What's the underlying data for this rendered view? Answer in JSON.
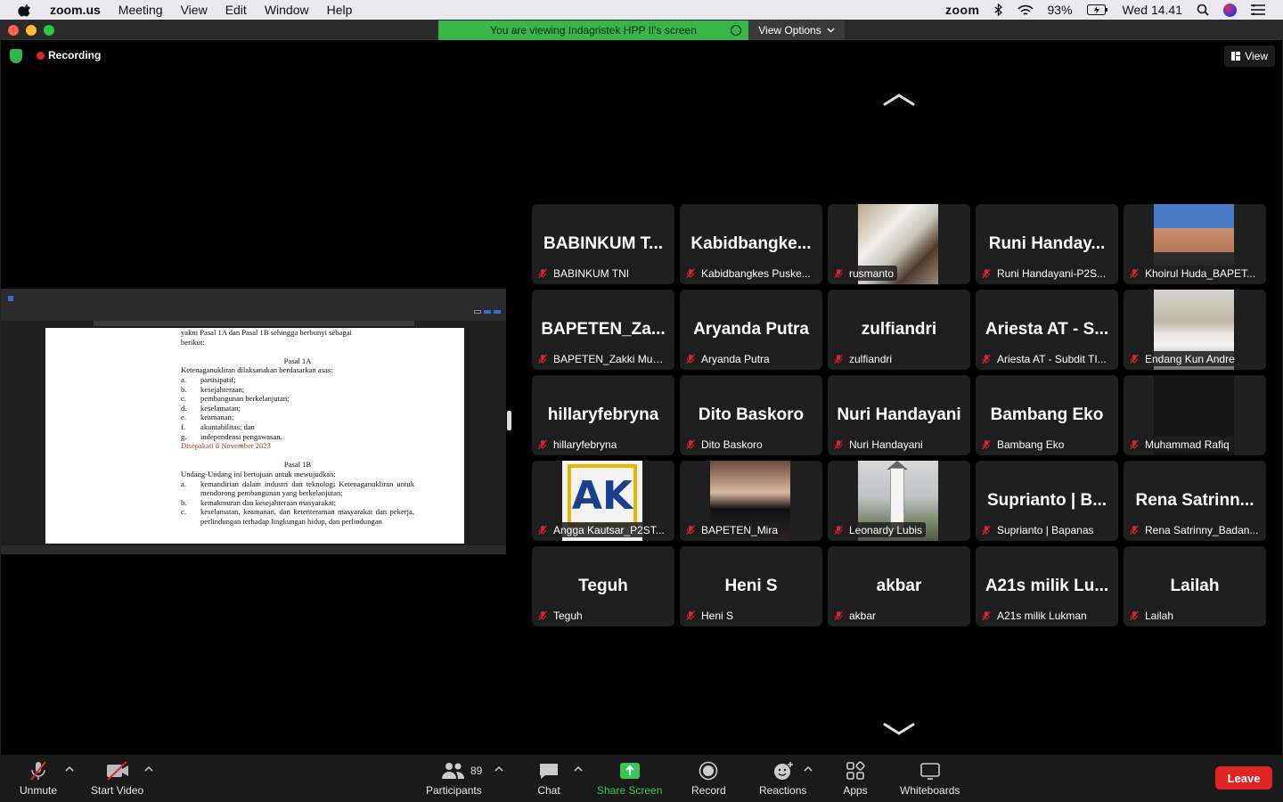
{
  "menubar": {
    "app": "zoom.us",
    "menus": [
      "Meeting",
      "View",
      "Edit",
      "Window",
      "Help"
    ],
    "zoom_logo": "zoom",
    "battery": "93%",
    "clock": "Wed 14.41"
  },
  "banner": {
    "viewing_text": "You are viewing Indagristek HPP II's screen",
    "view_options": "View Options"
  },
  "meeting": {
    "recording_label": "Recording",
    "view_label": "View"
  },
  "shared_doc": {
    "lines_top": [
      "yakni Pasal 1A dan Pasal 1B sehingga berbunyi sebagai",
      "berikut:"
    ],
    "pasal1a_title": "Pasal 1A",
    "pasal1a_intro": "Ketenaganukliran dilaksanakan berdasarkan asas:",
    "pasal1a_items": [
      {
        "k": "a.",
        "v": "partisipatif;"
      },
      {
        "k": "b.",
        "v": "kesejahteraan;"
      },
      {
        "k": "c.",
        "v": "pembangunan berkelanjutan;"
      },
      {
        "k": "d.",
        "v": "keselamatan;"
      },
      {
        "k": "e.",
        "v": "keamanan;"
      },
      {
        "k": "f.",
        "v": "akuntabilitas; dan"
      },
      {
        "k": "g.",
        "v": "independensi pengawasan."
      }
    ],
    "agreed_note": "Disepakati 8 November 2023",
    "pasal1b_title": "Pasal 1B",
    "pasal1b_intro": "Undang-Undang ini bertujuan untuk mewujudkan:",
    "pasal1b_items": [
      {
        "k": "a.",
        "v": "kemandirian dalam industri dan teknologi Ketenaganukliran untuk mendorong pembangunan yang berkelanjutan;"
      },
      {
        "k": "b.",
        "v": "kemakmuran dan kesejahteraan masyarakat;"
      },
      {
        "k": "c.",
        "v": "keselamatan, keamanan, dan ketenteraman masyarakat dan pekerja, perlindungan terhadap lingkungan hidup, dan perlindungan"
      }
    ]
  },
  "participants": [
    {
      "big": "BABINKUM T...",
      "label": "BABINKUM TNI",
      "photo": ""
    },
    {
      "big": "Kabidbangke...",
      "label": "Kabidbangkes Puske...",
      "photo": ""
    },
    {
      "big": "",
      "label": "rusmanto",
      "photo": "horse"
    },
    {
      "big": "Runi Handay...",
      "label": "Runi Handayani-P2S...",
      "photo": ""
    },
    {
      "big": "",
      "label": "Khoirul Huda_BAPET...",
      "photo": "man"
    },
    {
      "big": "BAPETEN_Za...",
      "label": "BAPETEN_Zakki Muh...",
      "photo": ""
    },
    {
      "big": "Aryanda Putra",
      "label": "Aryanda Putra",
      "photo": ""
    },
    {
      "big": "zulfiandri",
      "label": "zulfiandri",
      "photo": ""
    },
    {
      "big": "Ariesta AT - S...",
      "label": "Ariesta AT - Subdit TI...",
      "photo": ""
    },
    {
      "big": "",
      "label": "Endang Kun Andre",
      "photo": "woman1"
    },
    {
      "big": "hillaryfebryna",
      "label": "hillaryfebryna",
      "photo": ""
    },
    {
      "big": "Dito Baskoro",
      "label": "Dito Baskoro",
      "photo": ""
    },
    {
      "big": "Nuri Handayani",
      "label": "Nuri Handayani",
      "photo": ""
    },
    {
      "big": "Bambang Eko",
      "label": "Bambang Eko",
      "photo": ""
    },
    {
      "big": "",
      "label": "Muhammad Rafiq",
      "photo": "dark"
    },
    {
      "big": "",
      "label": "Angga Kautsar_P2ST...",
      "photo": "ak"
    },
    {
      "big": "",
      "label": "BAPETEN_Mira",
      "photo": "mira"
    },
    {
      "big": "",
      "label": "Leonardy Lubis",
      "photo": "clock"
    },
    {
      "big": "Suprianto | B...",
      "label": "Suprianto | Bapanas",
      "photo": ""
    },
    {
      "big": "Rena Satrinn...",
      "label": "Rena Satrinny_Badan...",
      "photo": ""
    },
    {
      "big": "Teguh",
      "label": "Teguh",
      "photo": ""
    },
    {
      "big": "Heni S",
      "label": "Heni S",
      "photo": ""
    },
    {
      "big": "akbar",
      "label": "akbar",
      "photo": ""
    },
    {
      "big": "A21s milik Lu...",
      "label": "A21s milik Lukman",
      "photo": ""
    },
    {
      "big": "Lailah",
      "label": "Lailah",
      "photo": ""
    }
  ],
  "ak_logo_text": "AK",
  "toolbar": {
    "unmute": "Unmute",
    "start_video": "Start Video",
    "participants": "Participants",
    "participants_count": "89",
    "chat": "Chat",
    "share_screen": "Share Screen",
    "record": "Record",
    "reactions": "Reactions",
    "apps": "Apps",
    "whiteboards": "Whiteboards",
    "leave": "Leave"
  },
  "colors": {
    "green_banner": "#39b54a",
    "leave_red": "#e02424",
    "share_green": "#35c759",
    "tile_bg": "#1f1f1f"
  }
}
